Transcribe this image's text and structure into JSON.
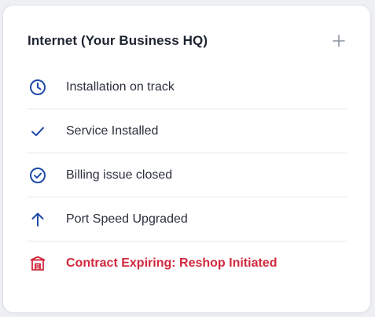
{
  "card": {
    "title": "Internet (Your Business HQ)",
    "expand_icon": "plus-icon"
  },
  "colors": {
    "icon_blue": "#1f4aa8",
    "alert_red": "#d1293d",
    "plus_gray": "#8a92a3"
  },
  "events": [
    {
      "icon": "clock-icon",
      "label": "Installation on track",
      "status": "normal"
    },
    {
      "icon": "checkmark-icon",
      "label": "Service Installed",
      "status": "normal"
    },
    {
      "icon": "check-circle-icon",
      "label": "Billing issue closed",
      "status": "normal"
    },
    {
      "icon": "arrow-up-icon",
      "label": "Port Speed Upgraded",
      "status": "normal"
    },
    {
      "icon": "storefront-icon",
      "label": "Contract Expiring: Reshop Initiated",
      "status": "alert"
    }
  ]
}
